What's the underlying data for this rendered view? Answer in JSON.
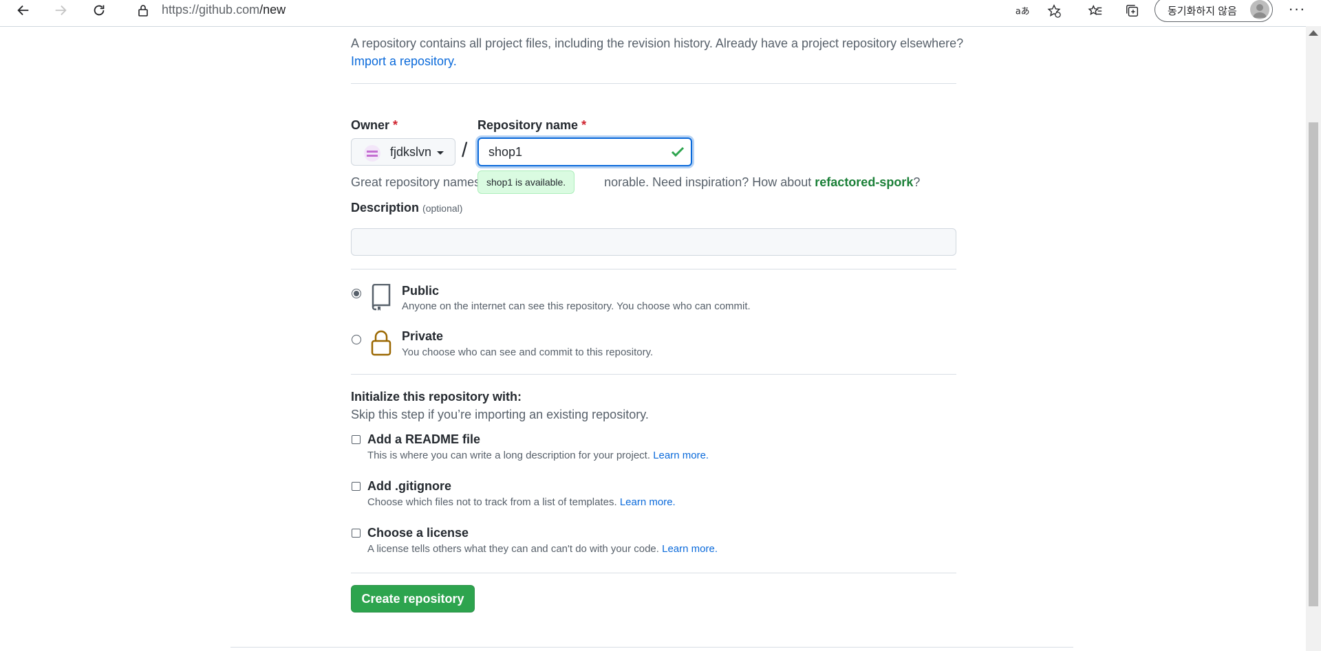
{
  "browser": {
    "url_host": "https://github.com",
    "url_path": "/new",
    "sync_label": "동기화하지 않음",
    "more": "···"
  },
  "page": {
    "intro_text": "A repository contains all project files, including the revision history. Already have a project repository elsewhere?",
    "import_link": "Import a repository.",
    "owner_label": "Owner",
    "required_mark": "*",
    "owner_name": "fjdkslvn",
    "slash": "/",
    "repo_label": "Repository name",
    "repo_value": "shop1",
    "hint_prefix": "Great repository names",
    "hint_middle": "norable. Need inspiration? How about ",
    "hint_suggestion": "refactored-spork",
    "hint_suffix": "?",
    "availability_tooltip": "shop1 is available.",
    "description_label": "Description",
    "description_optional": "(optional)",
    "visibility": {
      "public_title": "Public",
      "public_desc": "Anyone on the internet can see this repository. You choose who can commit.",
      "private_title": "Private",
      "private_desc": "You choose who can see and commit to this repository.",
      "selected": "public"
    },
    "init": {
      "title": "Initialize this repository with:",
      "subtitle": "Skip this step if you’re importing an existing repository.",
      "readme_title": "Add a README file",
      "readme_desc": "This is where you can write a long description for your project.",
      "gitignore_title": "Add .gitignore",
      "gitignore_desc": "Choose which files not to track from a list of templates.",
      "license_title": "Choose a license",
      "license_desc": "A license tells others what they can and can't do with your code.",
      "learn_more": "Learn more."
    },
    "create_button": "Create repository"
  },
  "colors": {
    "accent": "#0969da",
    "success": "#2da44e",
    "danger": "#cf222e",
    "lock_icon": "#9a6700"
  }
}
